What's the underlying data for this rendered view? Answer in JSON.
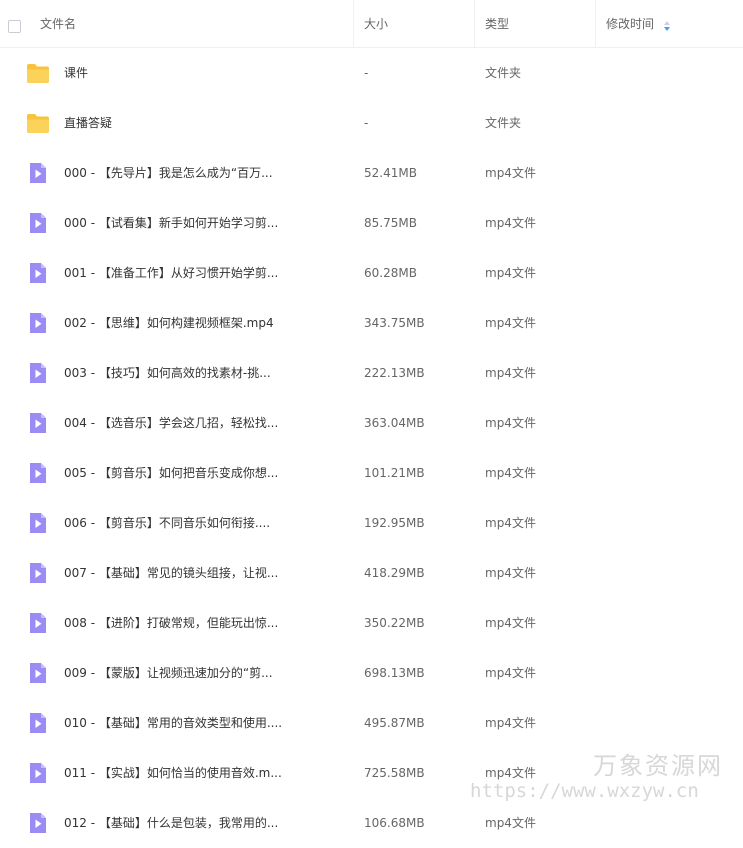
{
  "header": {
    "col_name": "文件名",
    "col_size": "大小",
    "col_type": "类型",
    "col_modified": "修改时间"
  },
  "colors": {
    "folder": "#f7c33c",
    "video_icon": "#9b8cf5",
    "sort_active": "#4a9eeb"
  },
  "rows": [
    {
      "kind": "folder",
      "icon": "folder-icon",
      "name": "课件",
      "size": "-",
      "type": "文件夹"
    },
    {
      "kind": "folder",
      "icon": "folder-icon",
      "name": "直播答疑",
      "size": "-",
      "type": "文件夹"
    },
    {
      "kind": "video",
      "icon": "video-file-icon",
      "name": "000 - 【先导片】我是怎么成为“百万...",
      "size": "52.41MB",
      "type": "mp4文件"
    },
    {
      "kind": "video",
      "icon": "video-file-icon",
      "name": "000 - 【试看集】新手如何开始学习剪...",
      "size": "85.75MB",
      "type": "mp4文件"
    },
    {
      "kind": "video",
      "icon": "video-file-icon",
      "name": "001 - 【准备工作】从好习惯开始学剪...",
      "size": "60.28MB",
      "type": "mp4文件"
    },
    {
      "kind": "video",
      "icon": "video-file-icon",
      "name": "002 - 【思维】如何构建视频框架.mp4",
      "size": "343.75MB",
      "type": "mp4文件"
    },
    {
      "kind": "video",
      "icon": "video-file-icon",
      "name": "003 - 【技巧】如何高效的找素材-挑...",
      "size": "222.13MB",
      "type": "mp4文件"
    },
    {
      "kind": "video",
      "icon": "video-file-icon",
      "name": "004 - 【选音乐】学会这几招，轻松找...",
      "size": "363.04MB",
      "type": "mp4文件"
    },
    {
      "kind": "video",
      "icon": "video-file-icon",
      "name": "005 - 【剪音乐】如何把音乐变成你想...",
      "size": "101.21MB",
      "type": "mp4文件"
    },
    {
      "kind": "video",
      "icon": "video-file-icon",
      "name": "006 - 【剪音乐】不同音乐如何衔接....",
      "size": "192.95MB",
      "type": "mp4文件"
    },
    {
      "kind": "video",
      "icon": "video-file-icon",
      "name": "007 - 【基础】常见的镜头组接，让视...",
      "size": "418.29MB",
      "type": "mp4文件"
    },
    {
      "kind": "video",
      "icon": "video-file-icon",
      "name": "008 - 【进阶】打破常规，但能玩出惊...",
      "size": "350.22MB",
      "type": "mp4文件"
    },
    {
      "kind": "video",
      "icon": "video-file-icon",
      "name": "009 - 【蒙版】让视频迅速加分的“剪...",
      "size": "698.13MB",
      "type": "mp4文件"
    },
    {
      "kind": "video",
      "icon": "video-file-icon",
      "name": "010 - 【基础】常用的音效类型和使用....",
      "size": "495.87MB",
      "type": "mp4文件"
    },
    {
      "kind": "video",
      "icon": "video-file-icon",
      "name": "011 - 【实战】如何恰当的使用音效.m...",
      "size": "725.58MB",
      "type": "mp4文件"
    },
    {
      "kind": "video",
      "icon": "video-file-icon",
      "name": "012 - 【基础】什么是包装，我常用的...",
      "size": "106.68MB",
      "type": "mp4文件"
    }
  ],
  "watermark": {
    "name": "万象资源网",
    "url": "https://www.wxzyw.cn"
  }
}
